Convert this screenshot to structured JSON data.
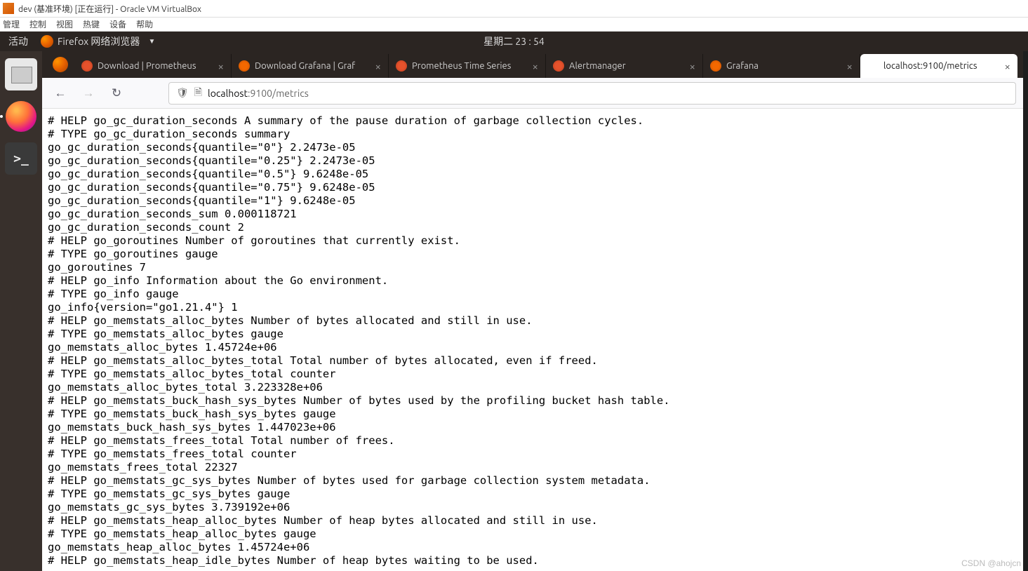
{
  "window": {
    "title": "dev (基准环境) [正在运行] - Oracle VM VirtualBox"
  },
  "vbox_menu": [
    "管理",
    "控制",
    "视图",
    "热键",
    "设备",
    "帮助"
  ],
  "gnome": {
    "activities": "活动",
    "firefox_label": "Firefox 网络浏览器",
    "clock": "星期二 23 : 54"
  },
  "tabs": [
    {
      "label": "Download | Prometheus",
      "favicon": "prom"
    },
    {
      "label": "Download Grafana | Graf",
      "favicon": "graf"
    },
    {
      "label": "Prometheus Time Series",
      "favicon": "prom"
    },
    {
      "label": "Alertmanager",
      "favicon": "prom"
    },
    {
      "label": "Grafana",
      "favicon": "graf"
    },
    {
      "label": "localhost:9100/metrics",
      "favicon": "",
      "active": true
    }
  ],
  "url": {
    "host": "localhost",
    "rest": ":9100/metrics"
  },
  "metrics_text": "# HELP go_gc_duration_seconds A summary of the pause duration of garbage collection cycles.\n# TYPE go_gc_duration_seconds summary\ngo_gc_duration_seconds{quantile=\"0\"} 2.2473e-05\ngo_gc_duration_seconds{quantile=\"0.25\"} 2.2473e-05\ngo_gc_duration_seconds{quantile=\"0.5\"} 9.6248e-05\ngo_gc_duration_seconds{quantile=\"0.75\"} 9.6248e-05\ngo_gc_duration_seconds{quantile=\"1\"} 9.6248e-05\ngo_gc_duration_seconds_sum 0.000118721\ngo_gc_duration_seconds_count 2\n# HELP go_goroutines Number of goroutines that currently exist.\n# TYPE go_goroutines gauge\ngo_goroutines 7\n# HELP go_info Information about the Go environment.\n# TYPE go_info gauge\ngo_info{version=\"go1.21.4\"} 1\n# HELP go_memstats_alloc_bytes Number of bytes allocated and still in use.\n# TYPE go_memstats_alloc_bytes gauge\ngo_memstats_alloc_bytes 1.45724e+06\n# HELP go_memstats_alloc_bytes_total Total number of bytes allocated, even if freed.\n# TYPE go_memstats_alloc_bytes_total counter\ngo_memstats_alloc_bytes_total 3.223328e+06\n# HELP go_memstats_buck_hash_sys_bytes Number of bytes used by the profiling bucket hash table.\n# TYPE go_memstats_buck_hash_sys_bytes gauge\ngo_memstats_buck_hash_sys_bytes 1.447023e+06\n# HELP go_memstats_frees_total Total number of frees.\n# TYPE go_memstats_frees_total counter\ngo_memstats_frees_total 22327\n# HELP go_memstats_gc_sys_bytes Number of bytes used for garbage collection system metadata.\n# TYPE go_memstats_gc_sys_bytes gauge\ngo_memstats_gc_sys_bytes 3.739192e+06\n# HELP go_memstats_heap_alloc_bytes Number of heap bytes allocated and still in use.\n# TYPE go_memstats_heap_alloc_bytes gauge\ngo_memstats_heap_alloc_bytes 1.45724e+06\n# HELP go_memstats_heap_idle_bytes Number of heap bytes waiting to be used.",
  "watermark": "CSDN @ahojcn"
}
